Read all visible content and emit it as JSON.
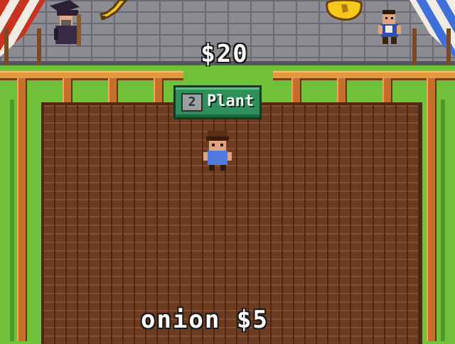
{
  "hud": {
    "money": "$20",
    "selected_item_name": "onion",
    "selected_item_price": "$5"
  },
  "action": {
    "key": "2",
    "label": "Plant"
  },
  "colors": {
    "soil": "#6b3b22",
    "grass": "#6fc13a",
    "wall": "#8c8c93",
    "fence": "#c56f2a",
    "button": "#2e8f5b"
  },
  "icons": [
    "banana-icon",
    "lemon-icon"
  ],
  "characters": [
    "wizard",
    "shopkeeper",
    "farmer"
  ]
}
